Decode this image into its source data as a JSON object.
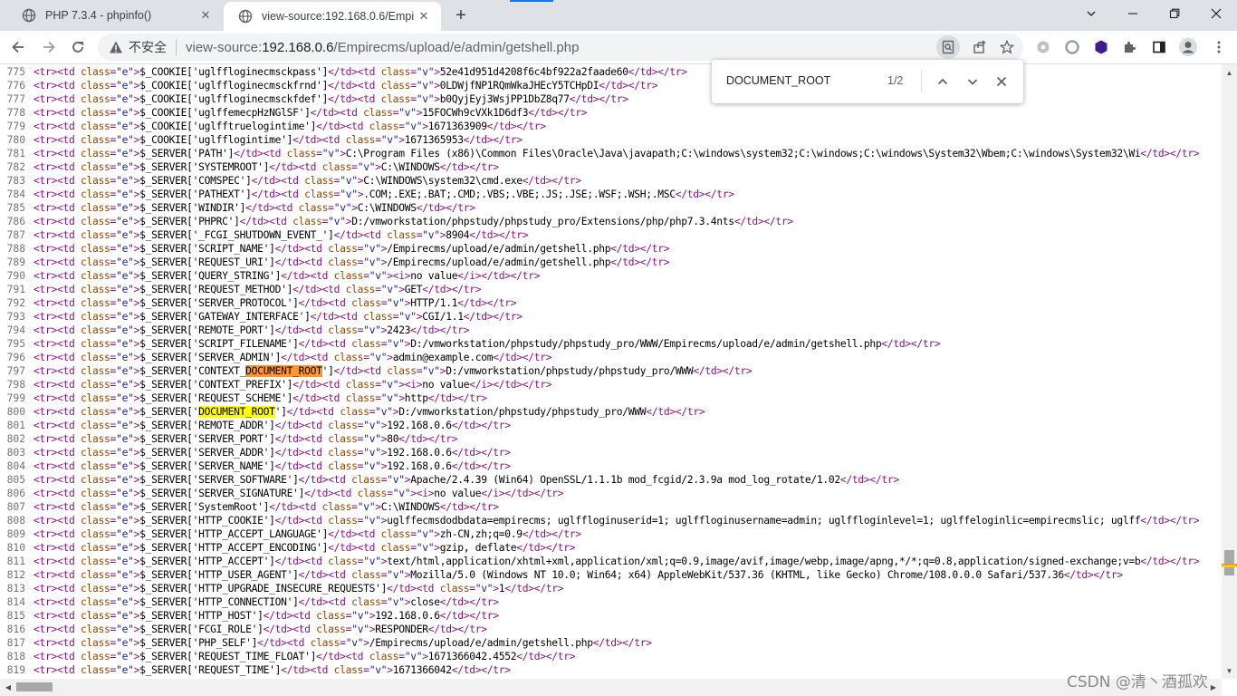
{
  "browser": {
    "tabs": [
      {
        "title": "PHP 7.3.4 - phpinfo()",
        "active": false
      },
      {
        "title": "view-source:192.168.0.6/Empir",
        "active": true
      }
    ],
    "address": {
      "security_label": "不安全",
      "url_prefix": "view-source:",
      "url_host": "192.168.0.6",
      "url_path": "/Empirecms/upload/e/admin/getshell.php"
    }
  },
  "find_bar": {
    "query": "DOCUMENT_ROOT",
    "count": "1/2"
  },
  "watermark": "CSDN @清丶酒孤欢",
  "source_lines": [
    {
      "n": "775",
      "key": "$_COOKIE['uglffloginecmsckpass']",
      "value": "52e41d951d4208f6c4bf922a2faade60"
    },
    {
      "n": "776",
      "key": "$_COOKIE['uglffloginecmsckfrnd']",
      "value": "0LDWjfNP1RQmWkaJHEcY5TCHpDI"
    },
    {
      "n": "777",
      "key": "$_COOKIE['uglffloginecmsckfdef']",
      "value": "b0QyjEyj3WsjPP1DbZ8q77"
    },
    {
      "n": "778",
      "key": "$_COOKIE['uglffemecpHzNGlSF']",
      "value": "15FOCWh9cVXk1D6df3"
    },
    {
      "n": "779",
      "key": "$_COOKIE['uglfftruelogintime']",
      "value": "1671363909"
    },
    {
      "n": "780",
      "key": "$_COOKIE['uglfflogintime']",
      "value": "1671365953"
    },
    {
      "n": "781",
      "key": "$_SERVER['PATH']",
      "value": "C:\\Program Files (x86)\\Common Files\\Oracle\\Java\\javapath;C:\\windows\\system32;C:\\windows;C:\\windows\\System32\\Wbem;C:\\windows\\System32\\Wi"
    },
    {
      "n": "782",
      "key": "$_SERVER['SYSTEMROOT']",
      "value": "C:\\WINDOWS"
    },
    {
      "n": "783",
      "key": "$_SERVER['COMSPEC']",
      "value": "C:\\WINDOWS\\system32\\cmd.exe"
    },
    {
      "n": "784",
      "key": "$_SERVER['PATHEXT']",
      "value": ".COM;.EXE;.BAT;.CMD;.VBS;.VBE;.JS;.JSE;.WSF;.WSH;.MSC"
    },
    {
      "n": "785",
      "key": "$_SERVER['WINDIR']",
      "value": "C:\\WINDOWS"
    },
    {
      "n": "786",
      "key": "$_SERVER['PHPRC']",
      "value": "D:/vmworkstation/phpstudy/phpstudy_pro/Extensions/php/php7.3.4nts"
    },
    {
      "n": "787",
      "key": "$_SERVER['_FCGI_SHUTDOWN_EVENT_']",
      "value": "8904"
    },
    {
      "n": "788",
      "key": "$_SERVER['SCRIPT_NAME']",
      "value": "/Empirecms/upload/e/admin/getshell.php"
    },
    {
      "n": "789",
      "key": "$_SERVER['REQUEST_URI']",
      "value": "/Empirecms/upload/e/admin/getshell.php"
    },
    {
      "n": "790",
      "key": "$_SERVER['QUERY_STRING']",
      "value": "<i>no value</i>"
    },
    {
      "n": "791",
      "key": "$_SERVER['REQUEST_METHOD']",
      "value": "GET"
    },
    {
      "n": "792",
      "key": "$_SERVER['SERVER_PROTOCOL']",
      "value": "HTTP/1.1"
    },
    {
      "n": "793",
      "key": "$_SERVER['GATEWAY_INTERFACE']",
      "value": "CGI/1.1"
    },
    {
      "n": "794",
      "key": "$_SERVER['REMOTE_PORT']",
      "value": "2423"
    },
    {
      "n": "795",
      "key": "$_SERVER['SCRIPT_FILENAME']",
      "value": "D:/vmworkstation/phpstudy/phpstudy_pro/WWW/Empirecms/upload/e/admin/getshell.php"
    },
    {
      "n": "796",
      "key": "$_SERVER['SERVER_ADMIN']",
      "value": "admin@example.com"
    },
    {
      "n": "797",
      "key_pre": "$_SERVER['CONTEXT_",
      "key_hl": "DOCUMENT_ROOT",
      "key_post": "']",
      "hl_type": "active",
      "value": "D:/vmworkstation/phpstudy/phpstudy_pro/WWW"
    },
    {
      "n": "798",
      "key": "$_SERVER['CONTEXT_PREFIX']",
      "value": "<i>no value</i>"
    },
    {
      "n": "799",
      "key": "$_SERVER['REQUEST_SCHEME']",
      "value": "http"
    },
    {
      "n": "800",
      "key_pre": "$_SERVER['",
      "key_hl": "DOCUMENT_ROOT",
      "key_post": "']",
      "hl_type": "match",
      "value": "D:/vmworkstation/phpstudy/phpstudy_pro/WWW"
    },
    {
      "n": "801",
      "key": "$_SERVER['REMOTE_ADDR']",
      "value": "192.168.0.6"
    },
    {
      "n": "802",
      "key": "$_SERVER['SERVER_PORT']",
      "value": "80"
    },
    {
      "n": "803",
      "key": "$_SERVER['SERVER_ADDR']",
      "value": "192.168.0.6"
    },
    {
      "n": "804",
      "key": "$_SERVER['SERVER_NAME']",
      "value": "192.168.0.6"
    },
    {
      "n": "805",
      "key": "$_SERVER['SERVER_SOFTWARE']",
      "value": "Apache/2.4.39 (Win64) OpenSSL/1.1.1b mod_fcgid/2.3.9a mod_log_rotate/1.02"
    },
    {
      "n": "806",
      "key": "$_SERVER['SERVER_SIGNATURE']",
      "value": "<i>no value</i>"
    },
    {
      "n": "807",
      "key": "$_SERVER['SystemRoot']",
      "value": "C:\\WINDOWS"
    },
    {
      "n": "808",
      "key": "$_SERVER['HTTP_COOKIE']",
      "value": "uglffecmsdodbdata=empirecms; uglffloginuserid=1; uglffloginusername=admin; uglffloginlevel=1; uglffeloginlic=empirecmslic; uglff"
    },
    {
      "n": "809",
      "key": "$_SERVER['HTTP_ACCEPT_LANGUAGE']",
      "value": "zh-CN,zh;q=0.9"
    },
    {
      "n": "810",
      "key": "$_SERVER['HTTP_ACCEPT_ENCODING']",
      "value": "gzip, deflate"
    },
    {
      "n": "811",
      "key": "$_SERVER['HTTP_ACCEPT']",
      "value": "text/html,application/xhtml+xml,application/xml;q=0.9,image/avif,image/webp,image/apng,*/*;q=0.8,application/signed-exchange;v=b"
    },
    {
      "n": "812",
      "key": "$_SERVER['HTTP_USER_AGENT']",
      "value": "Mozilla/5.0 (Windows NT 10.0; Win64; x64) AppleWebKit/537.36 (KHTML, like Gecko) Chrome/108.0.0.0 Safari/537.36"
    },
    {
      "n": "813",
      "key": "$_SERVER['HTTP_UPGRADE_INSECURE_REQUESTS']",
      "value": "1"
    },
    {
      "n": "814",
      "key": "$_SERVER['HTTP_CONNECTION']",
      "value": "close"
    },
    {
      "n": "815",
      "key": "$_SERVER['HTTP_HOST']",
      "value": "192.168.0.6"
    },
    {
      "n": "816",
      "key": "$_SERVER['FCGI_ROLE']",
      "value": "RESPONDER"
    },
    {
      "n": "817",
      "key": "$_SERVER['PHP_SELF']",
      "value": "/Empirecms/upload/e/admin/getshell.php"
    },
    {
      "n": "818",
      "key": "$_SERVER['REQUEST_TIME_FLOAT']",
      "value": "1671366042.4552"
    },
    {
      "n": "819",
      "key": "$_SERVER['REQUEST_TIME']",
      "value": "1671366042"
    }
  ]
}
